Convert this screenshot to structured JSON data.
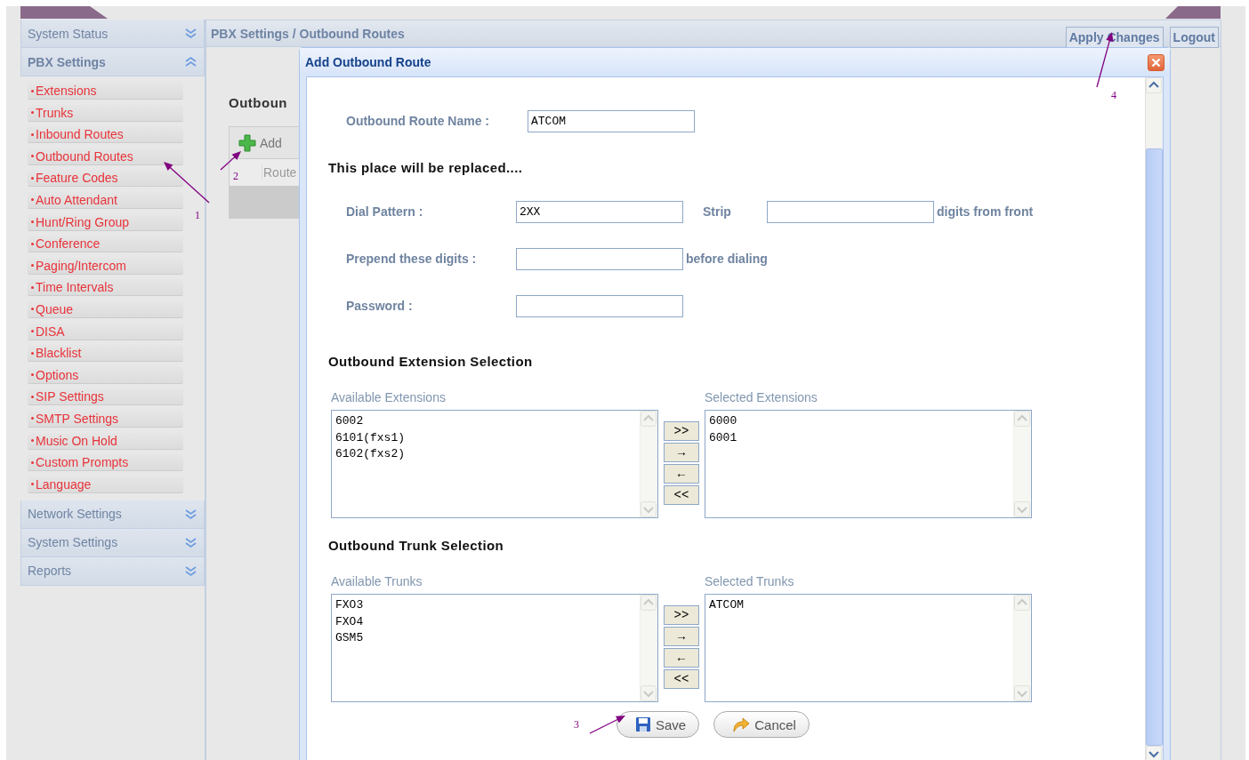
{
  "sidebar": {
    "sections": [
      {
        "title": "System Status",
        "expanded": false
      },
      {
        "title": "PBX Settings",
        "expanded": true,
        "items": [
          "Extensions",
          "Trunks",
          "Inbound Routes",
          "Outbound Routes",
          "Feature Codes",
          "Auto Attendant",
          "Hunt/Ring Group",
          "Conference",
          "Paging/Intercom",
          "Time Intervals",
          "Queue",
          "DISA",
          "Blacklist",
          "Options",
          "SIP Settings",
          "SMTP Settings",
          "Music On Hold",
          "Custom Prompts",
          "Language"
        ]
      },
      {
        "title": "Network Settings",
        "expanded": false
      },
      {
        "title": "System Settings",
        "expanded": false
      },
      {
        "title": "Reports",
        "expanded": false
      }
    ]
  },
  "breadcrumb": "PBX Settings / Outbound Routes",
  "header_buttons": [
    "Apply Changes",
    "Logout"
  ],
  "page": {
    "heading": "Outboun",
    "toolbar_button": "Add",
    "table": {
      "columns": [
        "Route"
      ]
    }
  },
  "dialog": {
    "title": "Add Outbound Route",
    "route_name": {
      "label": "Outbound Route Name :",
      "value": "ATCOM"
    },
    "note": "This place will be replaced....",
    "rows": [
      {
        "label": "Dial Pattern :",
        "value": "2XX",
        "extra": {
          "label": "Strip",
          "suffix": "digits from front"
        }
      },
      {
        "label": "Prepend these digits :",
        "suffix": "before dialing"
      },
      {
        "label": "Password :"
      }
    ],
    "selections": [
      {
        "heading": "Outbound Extension Selection",
        "available_label": "Available Extensions",
        "available": [
          "6002",
          "6101(fxs1)",
          "6102(fxs2)"
        ],
        "selected_label": "Selected Extensions",
        "selected": [
          "6000",
          "6001"
        ]
      },
      {
        "heading": "Outbound Trunk Selection",
        "available_label": "Available Trunks",
        "available": [
          "FXO3",
          "FXO4",
          "GSM5"
        ],
        "selected_label": "Selected Trunks",
        "selected": [
          "ATCOM"
        ]
      }
    ],
    "transfer_buttons": [
      ">>",
      "→",
      "←",
      "<<"
    ],
    "buttons": [
      {
        "kind": "save",
        "label": "Save"
      },
      {
        "kind": "cancel",
        "label": "Cancel"
      }
    ]
  },
  "annotations": [
    {
      "label": "1"
    },
    {
      "label": "2"
    },
    {
      "label": "3"
    },
    {
      "label": "4"
    }
  ]
}
